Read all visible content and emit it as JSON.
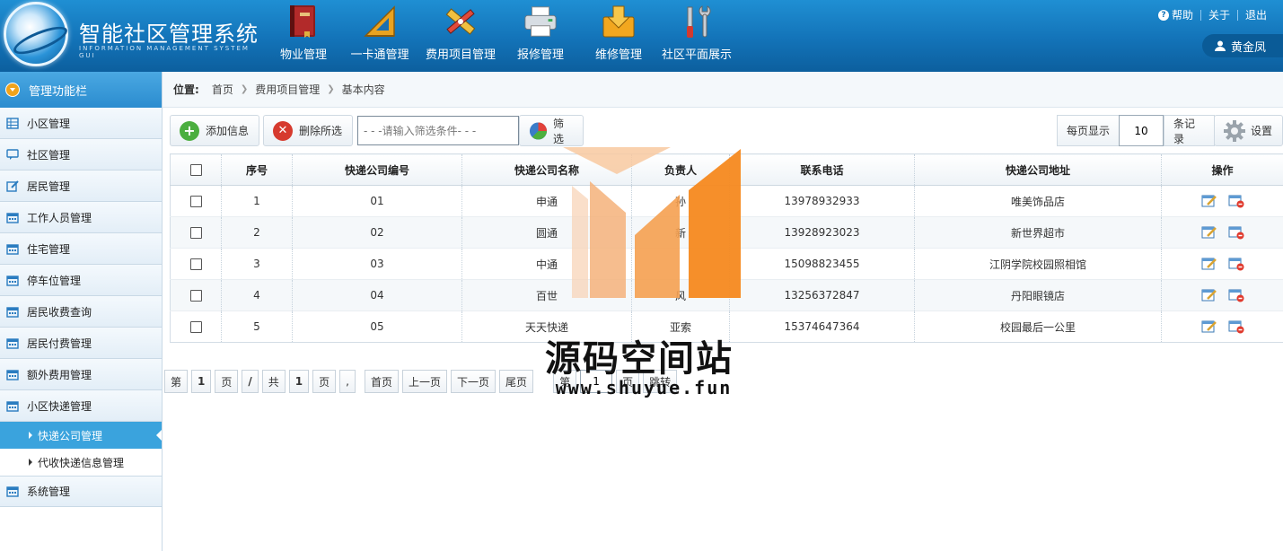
{
  "header": {
    "title": "智能社区管理系统",
    "subtitle": "INFORMATION MANAGEMENT SYSTEM GUI",
    "nav": [
      {
        "label": "物业管理",
        "icon": "book-icon"
      },
      {
        "label": "一卡通管理",
        "icon": "ruler-triangle-icon"
      },
      {
        "label": "费用项目管理",
        "icon": "pencil-ruler-icon"
      },
      {
        "label": "报修管理",
        "icon": "printer-icon"
      },
      {
        "label": "维修管理",
        "icon": "download-box-icon"
      },
      {
        "label": "社区平面展示",
        "icon": "tools-icon"
      }
    ],
    "links": {
      "help": "帮助",
      "about": "关于",
      "logout": "退出"
    },
    "user": "黄金凤"
  },
  "sidebar": {
    "title": "管理功能栏",
    "items": [
      {
        "label": "小区管理",
        "icon": "grid-icon"
      },
      {
        "label": "社区管理",
        "icon": "chat-icon"
      },
      {
        "label": "居民管理",
        "icon": "edit-icon"
      },
      {
        "label": "工作人员管理",
        "icon": "calendar-icon"
      },
      {
        "label": "住宅管理",
        "icon": "calendar-icon"
      },
      {
        "label": "停车位管理",
        "icon": "calendar-icon"
      },
      {
        "label": "居民收费查询",
        "icon": "calendar-icon"
      },
      {
        "label": "居民付费管理",
        "icon": "calendar-icon"
      },
      {
        "label": "额外费用管理",
        "icon": "calendar-icon"
      },
      {
        "label": "小区快递管理",
        "icon": "calendar-icon"
      }
    ],
    "subitems": [
      {
        "label": "快递公司管理",
        "active": true
      },
      {
        "label": "代收快递信息管理",
        "active": false
      }
    ],
    "last_item": {
      "label": "系统管理",
      "icon": "calendar-icon"
    }
  },
  "breadcrumb": {
    "label": "位置:",
    "items": [
      "首页",
      "费用项目管理",
      "基本内容"
    ]
  },
  "toolbar": {
    "add_label": "添加信息",
    "delete_label": "删除所选",
    "filter_placeholder": "- - -请输入筛选条件- - -",
    "filter_label": "筛选",
    "per_page_label": "每页显示",
    "per_page_value": "10",
    "records_label": "条记录",
    "settings_label": "设置"
  },
  "table": {
    "columns": [
      "序号",
      "快递公司编号",
      "快递公司名称",
      "负责人",
      "联系电话",
      "快递公司地址",
      "操作"
    ],
    "rows": [
      {
        "no": "1",
        "code": "01",
        "name": "申通",
        "manager": "孙",
        "phone": "13978932933",
        "address": "唯美饰品店"
      },
      {
        "no": "2",
        "code": "02",
        "name": "圆通",
        "manager": "新",
        "phone": "13928923023",
        "address": "新世界超市"
      },
      {
        "no": "3",
        "code": "03",
        "name": "中通",
        "manager": "",
        "phone": "15098823455",
        "address": "江阴学院校园照相馆"
      },
      {
        "no": "4",
        "code": "04",
        "name": "百世",
        "manager": "风",
        "phone": "13256372847",
        "address": "丹阳眼镜店"
      },
      {
        "no": "5",
        "code": "05",
        "name": "天天快递",
        "manager": "亚索",
        "phone": "15374647364",
        "address": "校园最后一公里"
      }
    ]
  },
  "pager": {
    "di": "第",
    "page_current": "1",
    "ye": "页",
    "slash": "/",
    "gong": "共",
    "page_total": "1",
    "ye2": "页",
    "comma": ",",
    "first": "首页",
    "prev": "上一页",
    "next": "下一页",
    "last": "尾页",
    "di2": "第",
    "jump_value": "1",
    "ye3": "页",
    "jump": "跳转"
  },
  "watermark": {
    "text": "源码空间站",
    "url": "www.shuyue.fun"
  },
  "colors": {
    "header": "#1373b8",
    "active": "#3aa3dd",
    "watermark_orange": "#f5891f"
  }
}
